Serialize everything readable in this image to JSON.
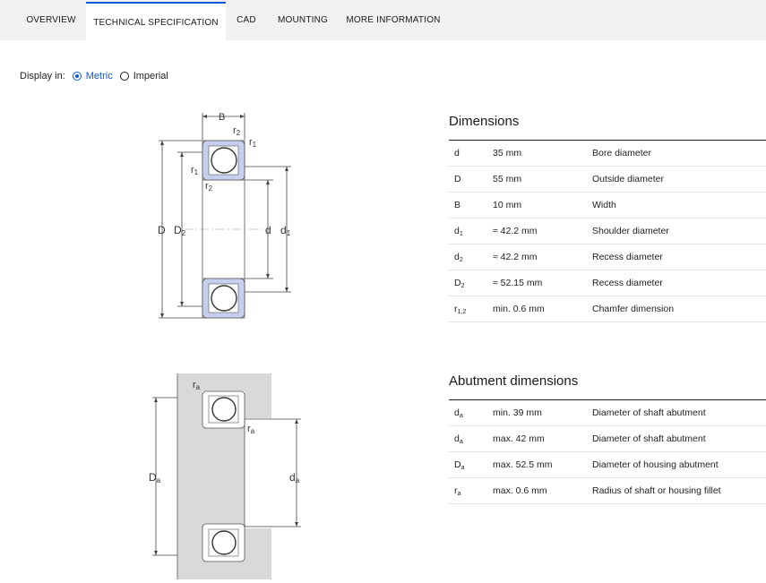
{
  "tabs": [
    {
      "label": "OVERVIEW"
    },
    {
      "label": "TECHNICAL SPECIFICATION"
    },
    {
      "label": "CAD"
    },
    {
      "label": "MOUNTING"
    },
    {
      "label": "MORE INFORMATION"
    }
  ],
  "active_tab": "TECHNICAL SPECIFICATION",
  "display": {
    "label": "Display in:",
    "options": [
      {
        "label": "Metric",
        "checked": true
      },
      {
        "label": "Imperial",
        "checked": false
      }
    ]
  },
  "drawing1": {
    "B": "B",
    "r1": "r",
    "r1_sub": "1",
    "r2": "r",
    "r2_sub": "2",
    "D": "D",
    "D2": "D",
    "D2_sub": "2",
    "d": "d",
    "d1": "d",
    "d1_sub": "1"
  },
  "drawing2": {
    "ra": "r",
    "ra_sub": "a",
    "Da": "D",
    "Da_sub": "a",
    "da": "d",
    "da_sub": "a"
  },
  "dimensions": {
    "title": "Dimensions",
    "rows": [
      {
        "sym": "d",
        "sub": "",
        "value": "35 mm",
        "desc": "Bore diameter"
      },
      {
        "sym": "D",
        "sub": "",
        "value": "55 mm",
        "desc": "Outside diameter"
      },
      {
        "sym": "B",
        "sub": "",
        "value": "10 mm",
        "desc": "Width"
      },
      {
        "sym": "d",
        "sub": "1",
        "value": "≈ 42.2 mm",
        "desc": "Shoulder diameter"
      },
      {
        "sym": "d",
        "sub": "2",
        "value": "≈ 42.2 mm",
        "desc": "Recess diameter"
      },
      {
        "sym": "D",
        "sub": "2",
        "value": "≈ 52.15 mm",
        "desc": "Recess diameter"
      },
      {
        "sym": "r",
        "sub": "1,2",
        "value": "min. 0.6 mm",
        "desc": "Chamfer dimension"
      }
    ]
  },
  "abutment": {
    "title": "Abutment dimensions",
    "rows": [
      {
        "sym": "d",
        "sub": "a",
        "value": "min. 39 mm",
        "desc": "Diameter of shaft abutment"
      },
      {
        "sym": "d",
        "sub": "a",
        "value": "max. 42 mm",
        "desc": "Diameter of shaft abutment"
      },
      {
        "sym": "D",
        "sub": "a",
        "value": "max. 52.5 mm",
        "desc": "Diameter of housing abutment"
      },
      {
        "sym": "r",
        "sub": "a",
        "value": "max. 0.6 mm",
        "desc": "Radius of shaft or housing fillet"
      }
    ]
  },
  "colors": {
    "accent": "#0f58d6",
    "seal": "#c5cfee",
    "housing": "#d9d9d9"
  }
}
